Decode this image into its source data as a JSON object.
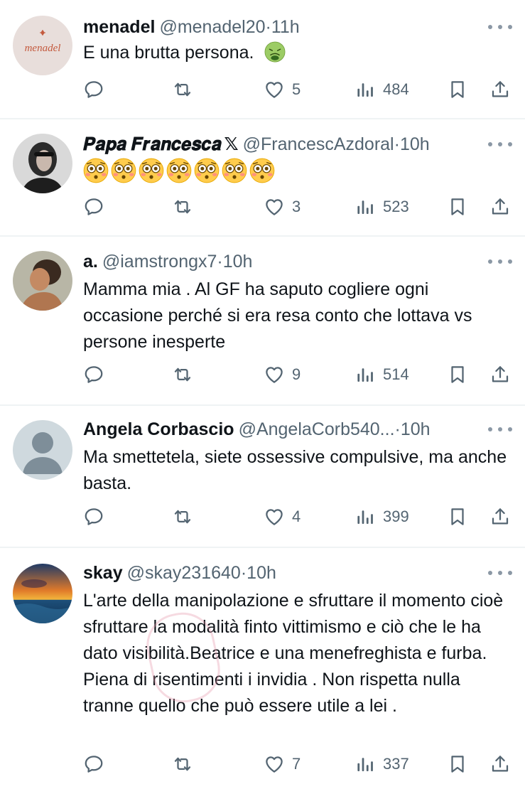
{
  "tweets": [
    {
      "name": "menadel",
      "handle": "@menadel20",
      "dot": "·",
      "time": "11h",
      "verified_x": false,
      "text": "E una brutta persona.",
      "emojis": [
        "nauseated-face"
      ],
      "avatar_logo": "menadel",
      "replies": "",
      "retweets": "",
      "likes": "5",
      "views": "484"
    },
    {
      "name": "𝑷𝒂𝒑𝒂 𝑭𝒓𝒂𝒏𝒄𝒆𝒔𝒄𝒂",
      "x_badge": "𝕏",
      "handle": "@FrancescAzdoral",
      "dot": "·",
      "time": "10h",
      "text": "",
      "emojis": [
        "flushed-face",
        "flushed-face",
        "flushed-face",
        "flushed-face",
        "flushed-face",
        "flushed-face",
        "flushed-face"
      ],
      "replies": "",
      "retweets": "",
      "likes": "3",
      "views": "523"
    },
    {
      "name": "a.",
      "handle": "@iamstrongx7",
      "dot": "·",
      "time": "10h",
      "text": "Mamma mia . Al GF ha saputo cogliere ogni occasione perché si era resa conto che lottava vs persone inesperte",
      "replies": "",
      "retweets": "",
      "likes": "9",
      "views": "514"
    },
    {
      "name": "Angela Corbascio",
      "handle": "@AngelaCorb540...",
      "dot": "·",
      "time": "10h",
      "text": "Ma smettetela, siete ossessive compulsive, ma anche basta.",
      "replies": "",
      "retweets": "",
      "likes": "4",
      "views": "399"
    },
    {
      "name": "skay",
      "handle": "@skay231640",
      "dot": "·",
      "time": "10h",
      "text": "L'arte della manipolazione e sfruttare il momento cioè sfruttare la modalità finto vittimismo e ciò che le ha dato visibilità.Beatrice e una menefreghista e furba. Piena di risentimenti i invidia . Non rispetta nulla tranne quello che può essere utile a lei .",
      "replies": "",
      "retweets": "",
      "likes": "7",
      "views": "337"
    }
  ],
  "icons": {
    "reply": "reply-icon",
    "retweet": "retweet-icon",
    "like": "heart-icon",
    "views": "views-icon",
    "bookmark": "bookmark-icon",
    "share": "share-icon",
    "more": "more-icon"
  },
  "colors": {
    "text": "#0f1419",
    "secondary": "#536471",
    "divider": "#eff3f4",
    "icon": "#536471"
  }
}
